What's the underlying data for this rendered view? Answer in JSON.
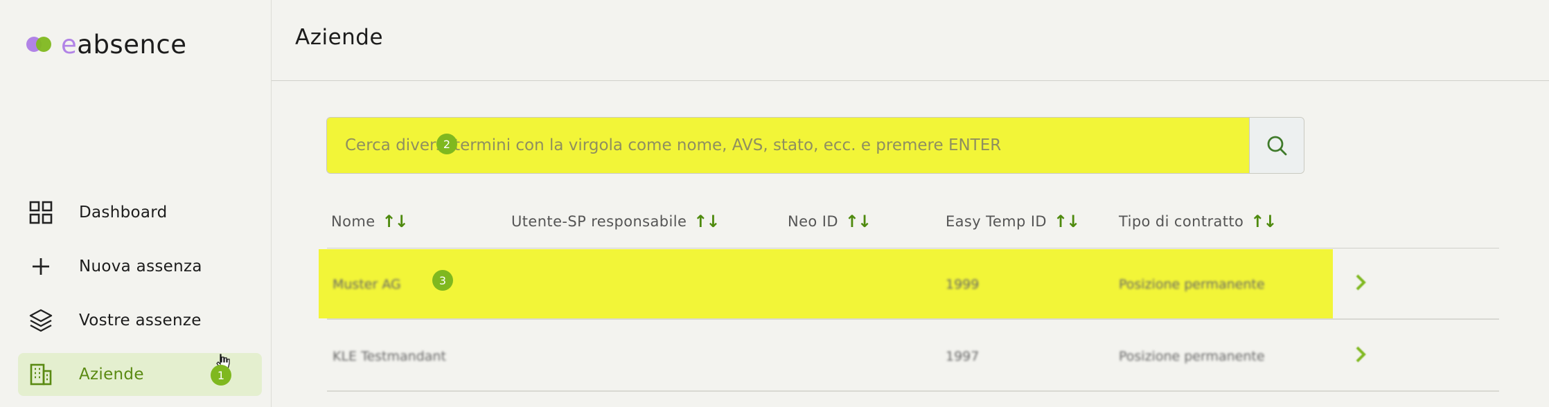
{
  "app": {
    "logo_prefix": "e",
    "logo_suffix": "absence"
  },
  "sidebar": {
    "items": [
      {
        "label": "Dashboard",
        "icon": "dashboard-grid-icon"
      },
      {
        "label": "Nuova assenza",
        "icon": "plus-icon"
      },
      {
        "label": "Vostre assenze",
        "icon": "layers-icon"
      },
      {
        "label": "Aziende",
        "icon": "building-icon",
        "active": true
      }
    ]
  },
  "header": {
    "title": "Aziende"
  },
  "search": {
    "placeholder": "Cerca diversi termini con la virgola come nome, AVS, stato, ecc. e premere ENTER",
    "button_icon": "search-icon"
  },
  "table": {
    "columns": [
      "Nome",
      "Utente-SP responsabile",
      "Neo ID",
      "Easy Temp ID",
      "Tipo di contratto"
    ],
    "sort_icon": "↑↓",
    "rows": [
      {
        "nome": "Muster AG",
        "utente": "",
        "neo_id": "",
        "easy_temp_id": "1999",
        "tipo": "Posizione permanente"
      },
      {
        "nome": "KLE Testmandant",
        "utente": "",
        "neo_id": "",
        "easy_temp_id": "1997",
        "tipo": "Posizione permanente"
      }
    ]
  },
  "steps": [
    "1",
    "2",
    "3"
  ],
  "colors": {
    "accent": "#7fb81f",
    "highlight": "#f2f538",
    "logo_purple": "#b183e6"
  }
}
